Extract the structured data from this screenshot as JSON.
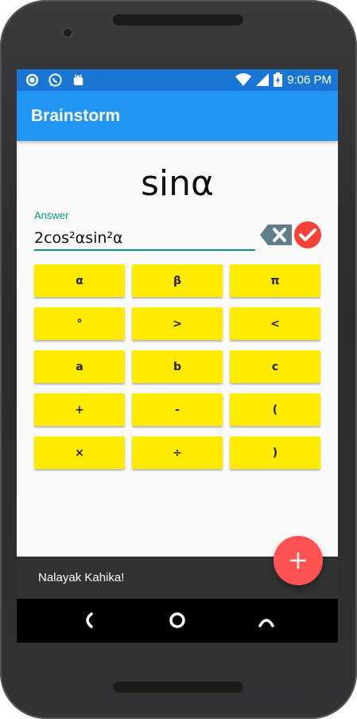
{
  "status_bar": {
    "time": "9:06 PM",
    "left_icons": [
      "sync-icon",
      "whatsapp-icon",
      "android-icon"
    ],
    "right_icons": [
      "wifi-icon",
      "signal-icon",
      "battery-charging-icon"
    ]
  },
  "app_bar": {
    "title": "Brainstorm"
  },
  "question": {
    "text": "sinα"
  },
  "answer": {
    "label": "Answer",
    "value": "2cos²αsin²α"
  },
  "actions": {
    "backspace_icon": "backspace-icon",
    "submit_icon": "check-icon"
  },
  "keypad": {
    "rows": [
      [
        "α",
        "β",
        "π"
      ],
      [
        "°",
        ">",
        "<"
      ],
      [
        "a",
        "b",
        "c"
      ],
      [
        "+",
        "-",
        "("
      ],
      [
        "×",
        "÷",
        ")"
      ]
    ]
  },
  "snackbar": {
    "message": "Nalayak Kahika!"
  },
  "fab": {
    "icon": "plus-icon"
  },
  "nav": {
    "items": [
      "back-icon",
      "home-icon",
      "recents-icon"
    ]
  },
  "colors": {
    "primary": "#2196f3",
    "primary_dark": "#1976d2",
    "accent_teal": "#009688",
    "key_yellow": "#ffeb00",
    "fab_red": "#ff5252",
    "check_red": "#f44336",
    "snackbar": "#323232"
  }
}
